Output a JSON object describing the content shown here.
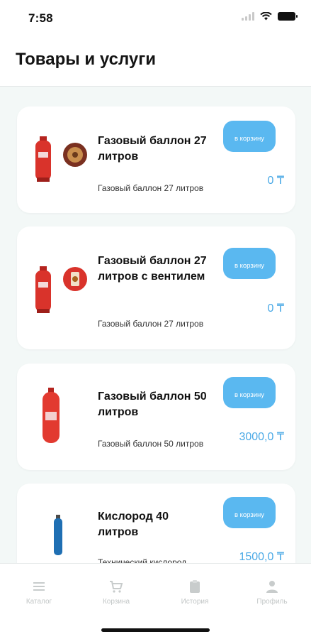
{
  "status": {
    "time": "7:58"
  },
  "header": {
    "title": "Товары и услуги"
  },
  "products": [
    {
      "title": "Газовый баллон 27 литров",
      "desc": "Газовый баллон 27 литров",
      "button": "в корзину",
      "price": "0 ₸"
    },
    {
      "title": "Газовый баллон 27 литров с вентилем",
      "desc": "Газовый баллон 27 литров",
      "button": "в корзину",
      "price": "0 ₸"
    },
    {
      "title": "Газовый баллон 50 литров",
      "desc": "Газовый баллон 50 литров",
      "button": "в корзину",
      "price": "3000,0 ₸"
    },
    {
      "title": "Кислород 40 литров",
      "desc": "Технический кислород",
      "button": "в корзину",
      "price": "1500,0 ₸"
    }
  ],
  "tabs": [
    {
      "label": "Каталог",
      "icon": "menu-icon"
    },
    {
      "label": "Корзина",
      "icon": "cart-icon"
    },
    {
      "label": "История",
      "icon": "clipboard-icon"
    },
    {
      "label": "Профиль",
      "icon": "user-icon"
    }
  ],
  "colors": {
    "accent": "#5ab8f0",
    "price": "#4aa9e6",
    "cylinder_red": "#d9332b",
    "oxygen_blue": "#1f6fb3"
  }
}
